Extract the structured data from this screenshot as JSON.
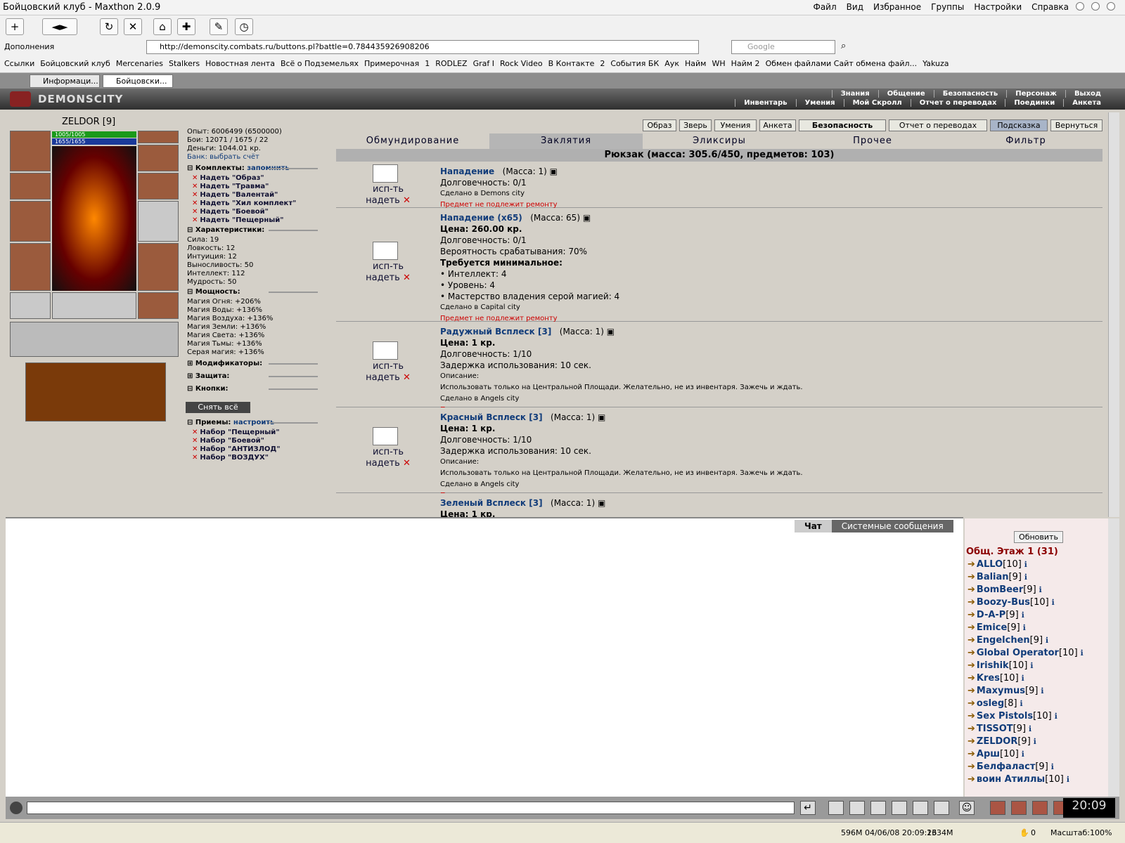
{
  "window": {
    "title": "Бойцовский клуб - Maxthon 2.0.9",
    "menu": [
      "Файл",
      "Вид",
      "Избранное",
      "Группы",
      "Настройки",
      "Справка"
    ]
  },
  "toolbar": {
    "addons": "Дополнения",
    "url": "http://demonscity.combats.ru/buttons.pl?battle=0.784435926908206",
    "search_placeholder": "Google"
  },
  "links": [
    "Ссылки",
    "Бойцовский клуб",
    "Mercenaries",
    "Stalkers",
    "Новостная лента",
    "Всё о Подземельях",
    "Примерочная",
    "1",
    "RODLEZ",
    "Graf I",
    "Rock Video",
    "В Контакте",
    "2",
    "События БК",
    "Аук",
    "Найм",
    "WH",
    "Найм 2",
    "Обмен файлами Сайт обмена файл...",
    "Yakuza"
  ],
  "tabs": [
    "Информаци...",
    "Бойцовски..."
  ],
  "game": {
    "logo": "DEMONSCITY",
    "nav_top": [
      "Знания",
      "Общение",
      "Безопасность",
      "Персонаж",
      "Выход"
    ],
    "nav_bottom": [
      "Инвентарь",
      "Умения",
      "Мой Скролл",
      "Отчет о переводах",
      "Поединки",
      "Анкета"
    ]
  },
  "character": {
    "name": "ZELDOR [9]",
    "hp": "1005/1005",
    "mana": "1655/1655",
    "exp": "Опыт: 6006499 (6500000)",
    "fights": "Бои: 12071 / 1675 / 22",
    "money": "Деньги: 1044.01 кр.",
    "bank": "Банк: выбрать счёт",
    "sets_title": "Комплекты:",
    "remember": "запомнить",
    "sets": [
      "Надеть \"Образ\"",
      "Надеть \"Травма\"",
      "Надеть \"Валентай\"",
      "Надеть \"Хил комплект\"",
      "Надеть \"Боевой\"",
      "Надеть \"Пещерный\""
    ],
    "stats_title": "Характеристики:",
    "stats": [
      "Сила: 19",
      "Ловкость: 12",
      "Интуиция: 12",
      "Выносливость: 50",
      "Интеллект: 112",
      "Мудрость: 50"
    ],
    "power_title": "Мощность:",
    "powers": [
      "Магия Огня: +206%",
      "Магия Воды: +136%",
      "Магия Воздуха: +136%",
      "Магия Земли: +136%",
      "Магия Света: +136%",
      "Магия Тьмы: +136%",
      "Серая магия: +136%"
    ],
    "modifiers": "Модификаторы:",
    "protection": "Защита:",
    "buttons": "Кнопки:",
    "remove_all": "Снять всё",
    "tricks_title": "Приемы:",
    "configure": "настроить",
    "tricks": [
      "Набор \"Пещерный\"",
      "Набор \"Боевой\"",
      "Набор \"АНТИЗЛОД\"",
      "Набор \"ВОЗДУХ\""
    ]
  },
  "inv_buttons": [
    "Образ",
    "Зверь",
    "Умения",
    "Анкета",
    "Безопасность",
    "Отчет о переводах",
    "Подсказка",
    "Вернуться"
  ],
  "categories": [
    "Обмундирование",
    "Заклятия",
    "Эликсиры",
    "Прочее",
    "Фильтр"
  ],
  "backpack": "Рюкзак (масса: 305.6/450, предметов: 103)",
  "action": {
    "use": "исп-ть",
    "wear": "надеть"
  },
  "items": [
    {
      "name": "Нападение",
      "mass": "(Масса: 1)",
      "lines": [
        "Долговечность: 0/1"
      ],
      "small": [
        "Сделано в Demons city"
      ],
      "repair": "Предмет не подлежит ремонту"
    },
    {
      "name": "Нападение (x65)",
      "mass": "(Масса: 65)",
      "price": "Цена: 260.00 кр.",
      "lines": [
        "Долговечность: 0/1",
        "Вероятность срабатывания: 70%"
      ],
      "req": "Требуется минимальное:",
      "reqs": [
        "• Интеллект: 4",
        "• Уровень: 4",
        "• Мастерство владения серой магией: 4"
      ],
      "small": [
        "Сделано в Capital city"
      ],
      "repair": "Предмет не подлежит ремонту"
    },
    {
      "name": "Радужный Всплеск [3]",
      "mass": "(Масса: 1)",
      "price": "Цена: 1 кр.",
      "lines": [
        "Долговечность: 1/10",
        "Задержка использования: 10 сек."
      ],
      "small": [
        "Описание:",
        "Использовать только на Центральной Площади. Желательно, не из инвентаря. Зажечь и ждать.",
        "Сделано в Angels city"
      ],
      "repair": "Предмет не подлежит ремонту"
    },
    {
      "name": "Красный Всплеск [3]",
      "mass": "(Масса: 1)",
      "price": "Цена: 1 кр.",
      "lines": [
        "Долговечность: 1/10",
        "Задержка использования: 10 сек."
      ],
      "small": [
        "Описание:",
        "Использовать только на Центральной Площади. Желательно, не из инвентаря. Зажечь и ждать.",
        "Сделано в Angels city"
      ],
      "repair": "Предмет не подлежит ремонту"
    },
    {
      "name": "Зеленый Всплеск [3]",
      "mass": "(Масса: 1)",
      "price": "Цена: 1 кр."
    }
  ],
  "chat": {
    "tab_chat": "Чат",
    "tab_system": "Системные сообщения",
    "refresh": "Обновить",
    "floor": "Общ. Этаж 1 (31)"
  },
  "users": [
    {
      "n": "ALLO",
      "l": "[10]"
    },
    {
      "n": "Balian",
      "l": "[9]"
    },
    {
      "n": "BomBeer",
      "l": "[9]"
    },
    {
      "n": "Boozy-Bus",
      "l": "[10]"
    },
    {
      "n": "D-A-P",
      "l": "[9]"
    },
    {
      "n": "Emice",
      "l": "[9]"
    },
    {
      "n": "Engelchen",
      "l": "[9]"
    },
    {
      "n": "Global Operator",
      "l": "[10]"
    },
    {
      "n": "Irishik",
      "l": "[10]"
    },
    {
      "n": "Kres",
      "l": "[10]"
    },
    {
      "n": "Maxymus",
      "l": "[9]"
    },
    {
      "n": "osleg",
      "l": "[8]"
    },
    {
      "n": "Sex Pistols",
      "l": "[10]"
    },
    {
      "n": "TISSOT",
      "l": "[9]"
    },
    {
      "n": "ZELDOR",
      "l": "[9]"
    },
    {
      "n": "Арш",
      "l": "[10]"
    },
    {
      "n": "Белфаласт",
      "l": "[9]"
    },
    {
      "n": "воин Атиллы",
      "l": "[10]"
    }
  ],
  "clock": "20:09",
  "status": {
    "mem": "596M 04/06/08 20:09:26",
    "mem2": "1334M",
    "count": "0",
    "zoom": "Масштаб:100%"
  }
}
